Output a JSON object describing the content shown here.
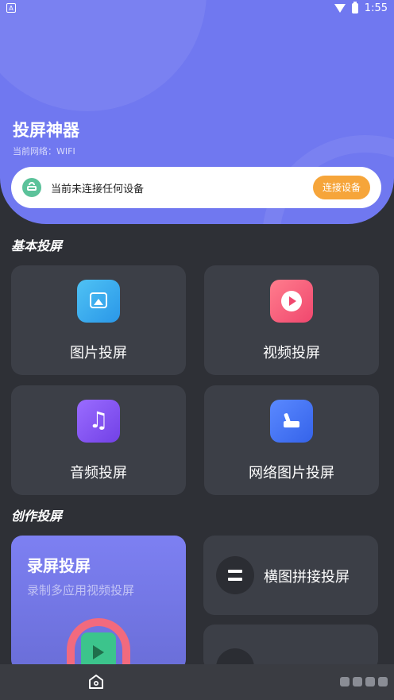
{
  "status_bar": {
    "left_badge": "A",
    "time": "1:55"
  },
  "header": {
    "title": "投屏神器",
    "network": "当前网络：WIFI"
  },
  "connection": {
    "status_text": "当前未连接任何设备",
    "button_label": "连接设备"
  },
  "sections": {
    "basic": "基本投屏",
    "creative": "创作投屏"
  },
  "basic_tiles": [
    {
      "label": "图片投屏",
      "icon": "image-icon"
    },
    {
      "label": "视频投屏",
      "icon": "video-play-icon"
    },
    {
      "label": "音频投屏",
      "icon": "music-note-icon"
    },
    {
      "label": "网络图片投屏",
      "icon": "web-image-icon"
    }
  ],
  "creative": {
    "record": {
      "title": "录屏投屏",
      "subtitle": "录制多应用视频投屏"
    },
    "stitch": {
      "label": "横图拼接投屏",
      "icon": "equals-icon"
    }
  },
  "colors": {
    "header": "#7078f0",
    "background": "#2e3036",
    "card": "#3c3f47",
    "accent": "#f6a53a"
  }
}
